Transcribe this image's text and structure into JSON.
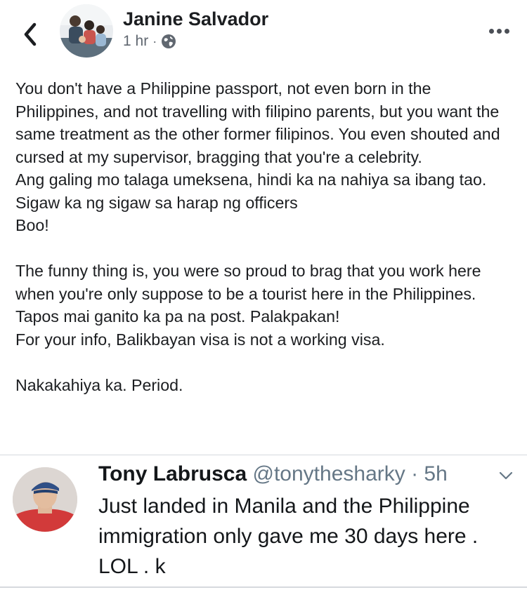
{
  "post": {
    "author_name": "Janine Salvador",
    "time": "1 hr",
    "separator": "·",
    "paragraphs": [
      "You don't have a Philippine passport, not even born in the Philippines, and not travelling with filipino parents, but you want the same treatment as the other former filipinos. You even shouted and cursed at my supervisor, bragging that you're a celebrity.",
      "Ang galing mo talaga umeksena, hindi ka na nahiya sa ibang tao. Sigaw ka ng sigaw sa harap ng officers",
      "Boo!",
      "The funny thing is, you were so proud to brag that you work here when you're only suppose to be a tourist here in the Philippines.",
      "Tapos mai ganito ka pa na post. Palakpakan!",
      "For your info, Balikbayan visa is not a working visa.",
      "Nakakahiya ka. Period."
    ]
  },
  "tweet": {
    "name": "Tony Labrusca",
    "handle": "@tonythesharky",
    "time": "· 5h",
    "text": "Just landed in Manila and the Philippine immigration only gave me 30 days here . LOL . k"
  },
  "icons": {
    "back": "chevron-left-icon",
    "privacy": "globe-icon",
    "more": "more-horizontal-icon",
    "tweet_menu": "chevron-down-icon"
  },
  "colors": {
    "text": "#1c1e21",
    "meta": "#606770",
    "twitter_handle": "#657786",
    "divider": "#d6d9dd"
  }
}
